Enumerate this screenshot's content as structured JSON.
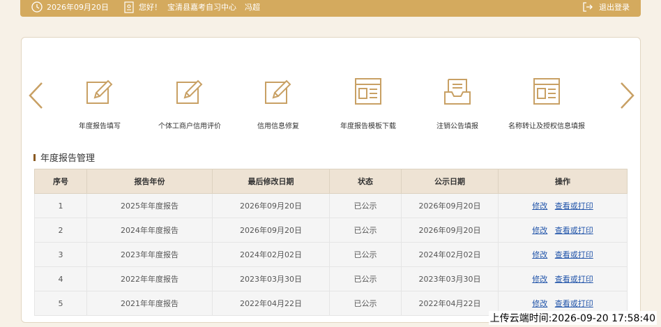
{
  "topbar": {
    "date": "2026年09月20日",
    "greeting": "您好！",
    "org": "宝清县嘉考自习中心",
    "user": "冯超",
    "logout": "退出登录"
  },
  "tiles": [
    {
      "label": "年度报告填写",
      "icon": "edit-icon"
    },
    {
      "label": "个体工商户信用评价",
      "icon": "edit-icon"
    },
    {
      "label": "信用信息修复",
      "icon": "edit-icon"
    },
    {
      "label": "年度报告模板下载",
      "icon": "template-icon"
    },
    {
      "label": "注销公告填报",
      "icon": "inbox-icon"
    },
    {
      "label": "名称转让及授权信息填报",
      "icon": "template-icon"
    }
  ],
  "section": {
    "title": "年度报告管理"
  },
  "table": {
    "headers": [
      "序号",
      "报告年份",
      "最后修改日期",
      "状态",
      "公示日期",
      "操作"
    ],
    "edit_label": "修改",
    "view_label": "查看或打印",
    "rows": [
      {
        "no": "1",
        "year": "2025年年度报告",
        "modified": "2026年09月20日",
        "status": "已公示",
        "published": "2026年09月20日"
      },
      {
        "no": "2",
        "year": "2024年年度报告",
        "modified": "2026年09月20日",
        "status": "已公示",
        "published": "2026年09月20日"
      },
      {
        "no": "3",
        "year": "2023年年度报告",
        "modified": "2024年02月02日",
        "status": "已公示",
        "published": "2024年02月02日"
      },
      {
        "no": "4",
        "year": "2022年年度报告",
        "modified": "2023年03月30日",
        "status": "已公示",
        "published": "2023年03月30日"
      },
      {
        "no": "5",
        "year": "2021年年度报告",
        "modified": "2022年04月22日",
        "status": "已公示",
        "published": "2022年04月22日"
      }
    ]
  },
  "watermark": "上传云端时间:2026-09-20 17:58:40",
  "colors": {
    "accent": "#d4aa5e",
    "icon": "#c8a064",
    "link": "#2255aa",
    "header_bg": "#eee3d4"
  }
}
